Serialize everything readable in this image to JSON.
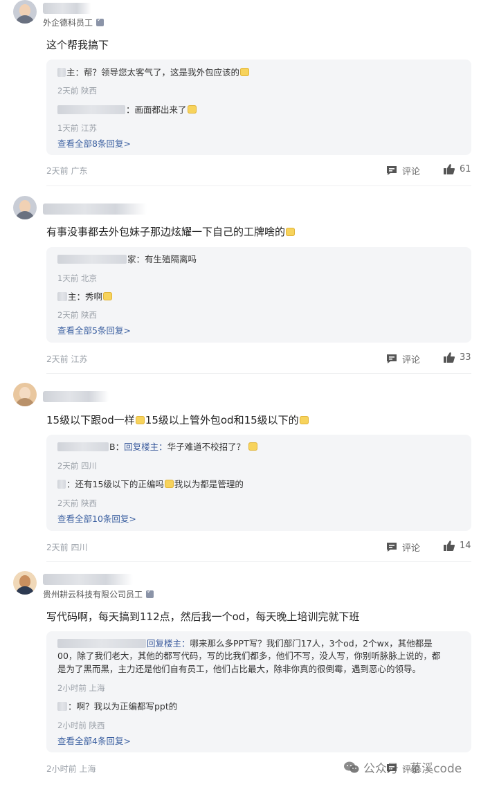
{
  "comments": [
    {
      "company": "外企德科员工",
      "text": "这个帮我搞下",
      "replies": [
        {
          "suffix": "主：帮？领导您太客气了，这是我外包应该的",
          "meta": "2天前 陕西"
        },
        {
          "suffix": "：画面都出来了",
          "meta": "1天前 江苏"
        }
      ],
      "view_all": "查看全部8条回复>",
      "meta": "2天前 广东",
      "comment_label": "评论",
      "likes": "61"
    },
    {
      "company": "",
      "text": "有事没事都去外包妹子那边炫耀一下自己的工牌啥的",
      "replies": [
        {
          "suffix": "家：有生殖隔离吗",
          "meta": "1天前 北京"
        },
        {
          "suffix": "主：秀啊",
          "meta": "2天前 陕西"
        }
      ],
      "view_all": "查看全部5条回复>",
      "meta": "2天前 江苏",
      "comment_label": "评论",
      "likes": "33"
    },
    {
      "company": "",
      "text_a": "15级以下跟od一样",
      "text_b": "15级以上管外包od和15级以下的",
      "replies": [
        {
          "prefix": "B：",
          "reply_to": "回复楼主：",
          "suffix": "华子难道不校招了？",
          "meta": "2天前 四川"
        },
        {
          "suffix": "：还有15级以下的正编吗",
          "suffix2": "我以为都是管理的",
          "meta": "2天前 陕西"
        }
      ],
      "view_all": "查看全部10条回复>",
      "meta": "2天前 四川",
      "comment_label": "评论",
      "likes": "14"
    },
    {
      "company": "贵州耕云科技有限公司员工",
      "text": "写代码啊，每天搞到112点，然后我一个od，每天晚上培训完就下班",
      "replies": [
        {
          "reply_to": "回复楼主：",
          "line1": "哪来那么多PPT写？我们部门17人，3个od，2个wx，其他都是",
          "line2": "00，除了我们老大，其他的都写代码，写的比我们都多，他们不写，没人写，你别听脉脉上说的，都",
          "line3": "是为了黑而黑，主力还是他们自有员工，他们占比最大，除非你真的很倒霉，遇到恶心的领导。",
          "meta": "2小时前 上海"
        },
        {
          "suffix": "：啊？我以为正编都写ppt的",
          "meta": "2小时前 陕西"
        }
      ],
      "view_all": "查看全部4条回复>",
      "meta": "2小时前 上海",
      "comment_label": "评论",
      "likes": ""
    }
  ],
  "watermark": "公众号 · 慕溪code",
  "colors": {
    "link": "#3a5fa0",
    "reply_bg": "#f4f5f7",
    "meta": "#9aa0a8"
  }
}
